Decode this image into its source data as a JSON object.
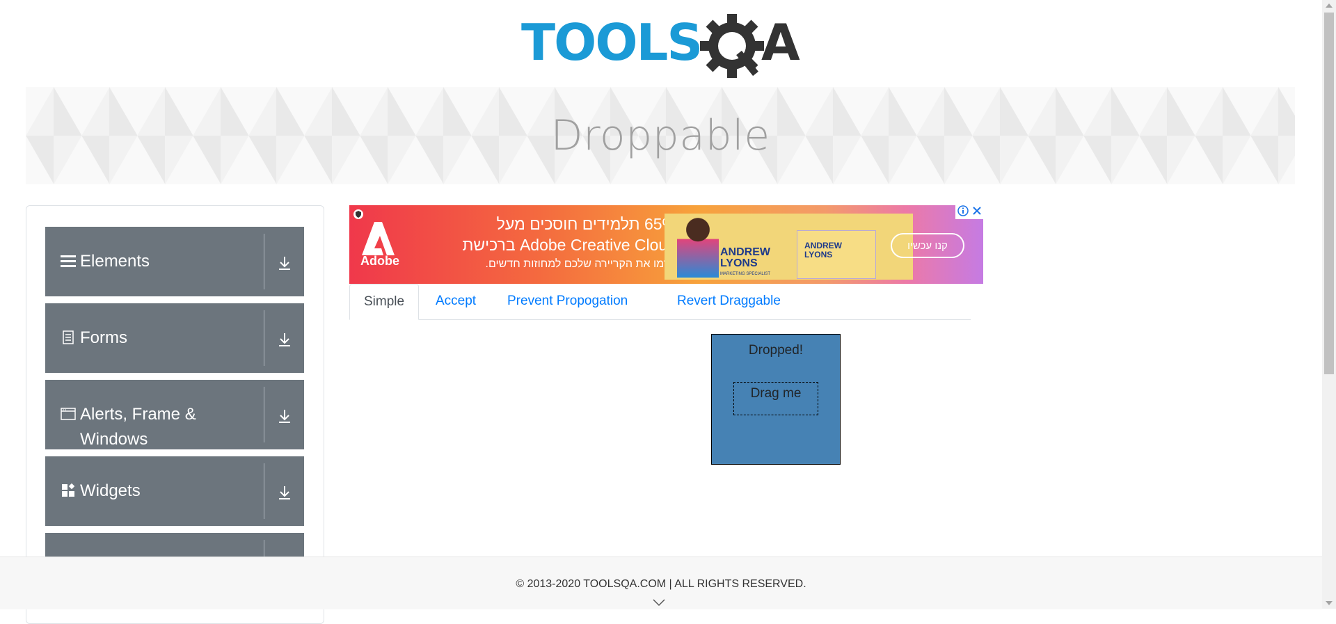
{
  "header": {
    "logo_text_left": "TOOLS",
    "logo_text_right": "A",
    "logo_colors": {
      "blue": "#1b9ad6",
      "gray": "#333333"
    }
  },
  "banner": {
    "title": "Droppable"
  },
  "sidebar": {
    "groups": [
      {
        "label": "Elements",
        "icon": "hamburger-icon"
      },
      {
        "label": "Forms",
        "icon": "document-icon"
      },
      {
        "label": "Alerts, Frame & Windows",
        "icon": "window-icon"
      },
      {
        "label": "Widgets",
        "icon": "widgets-icon"
      },
      {
        "label": "",
        "icon": ""
      }
    ],
    "group_color": "#6c757d"
  },
  "ad": {
    "brand": "Adobe",
    "line1": "65% תלמידים חוסכים מעל",
    "line2": "Adobe Creative Cloud ברכישת",
    "line3": "קדמו את הקריירה שלכם למחוזות חדשים.",
    "person_name": "ANDREW\nLYONS",
    "person_title": "MARKETING SPECIALIST",
    "card_name": "ANDREW\nLYONS",
    "cta": "קנו עכשיו"
  },
  "tabs": [
    {
      "label": "Simple",
      "active": true
    },
    {
      "label": "Accept",
      "active": false
    },
    {
      "label": "Prevent Propogation",
      "active": false
    },
    {
      "label": "Revert Draggable",
      "active": false
    }
  ],
  "droppable": {
    "drop_label": "Dropped!",
    "drag_label": "Drag me",
    "drop_color": "#4682b4"
  },
  "footer": {
    "copyright": "© 2013-2020 TOOLSQA.COM | ALL RIGHTS RESERVED."
  }
}
